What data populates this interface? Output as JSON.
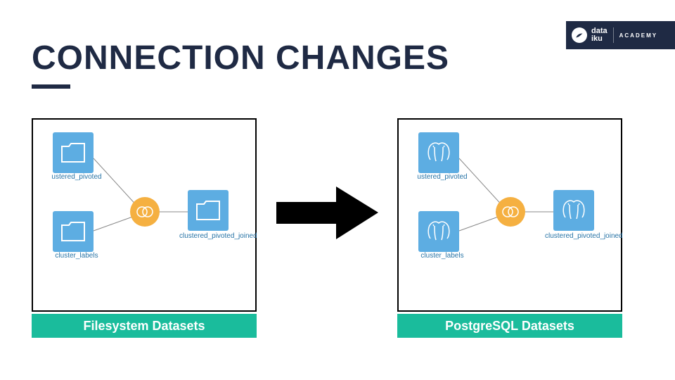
{
  "title": "CONNECTION CHANGES",
  "logo": {
    "main_line1": "data",
    "main_line2": "iku",
    "sub": "ACADEMY"
  },
  "arrow_color": "#000000",
  "boxes": {
    "left": {
      "caption": "Filesystem Datasets",
      "nodes": {
        "top": "ustered_pivoted",
        "bottom": "cluster_labels",
        "right": "clustered_pivoted_joined"
      },
      "icon_type": "folder"
    },
    "right": {
      "caption": "PostgreSQL Datasets",
      "nodes": {
        "top": "ustered_pivoted",
        "bottom": "cluster_labels",
        "right": "clustered_pivoted_joined"
      },
      "icon_type": "postgres"
    }
  },
  "colors": {
    "node": "#5dade2",
    "join": "#f5b041",
    "caption": "#1abc9c",
    "title": "#1f2a44"
  }
}
